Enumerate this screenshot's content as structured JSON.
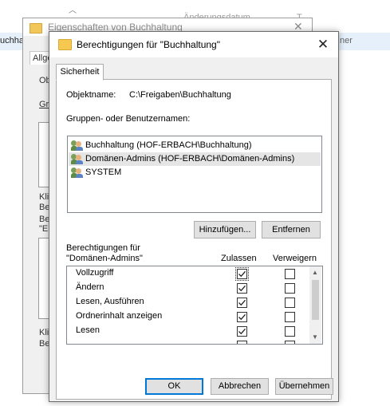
{
  "explorer": {
    "column_date": "Änderungsdatum",
    "column_type": "T",
    "row_name_fragment": "uchha",
    "row_type_fragment": "ner"
  },
  "back_dialog": {
    "title": "Eigenschaften von Buchhaltung",
    "tab_fragment": "Allge",
    "frag_ob": "Ob",
    "frag_gr": "Gr",
    "frag_kli1": "Kli",
    "frag_be1": "Be",
    "frag_be2": "Be",
    "frag_e": "\"E",
    "frag_kli2": "Kli",
    "frag_be3": "Be"
  },
  "dialog": {
    "title": "Berechtigungen für \"Buchhaltung\"",
    "tab": "Sicherheit",
    "object_name_label": "Objektname:",
    "object_name_value": "C:\\Freigaben\\Buchhaltung",
    "groups_label": "Gruppen- oder Benutzernamen:",
    "groups": [
      {
        "label": "Buchhaltung (HOF-ERBACH\\Buchhaltung)",
        "selected": false
      },
      {
        "label": "Domänen-Admins (HOF-ERBACH\\Domänen-Admins)",
        "selected": true
      },
      {
        "label": "SYSTEM",
        "selected": false
      }
    ],
    "add_button": "Hinzufügen...",
    "remove_button": "Entfernen",
    "permissions_for_line1": "Berechtigungen für",
    "permissions_for_line2": "\"Domänen-Admins\"",
    "allow_header": "Zulassen",
    "deny_header": "Verweigern",
    "permissions": [
      {
        "name": "Vollzugriff",
        "allow": true,
        "deny": false
      },
      {
        "name": "Ändern",
        "allow": true,
        "deny": false
      },
      {
        "name": "Lesen, Ausführen",
        "allow": true,
        "deny": false
      },
      {
        "name": "Ordnerinhalt anzeigen",
        "allow": true,
        "deny": false
      },
      {
        "name": "Lesen",
        "allow": true,
        "deny": false
      }
    ],
    "ok_button": "OK",
    "cancel_button": "Abbrechen",
    "apply_button": "Übernehmen"
  }
}
